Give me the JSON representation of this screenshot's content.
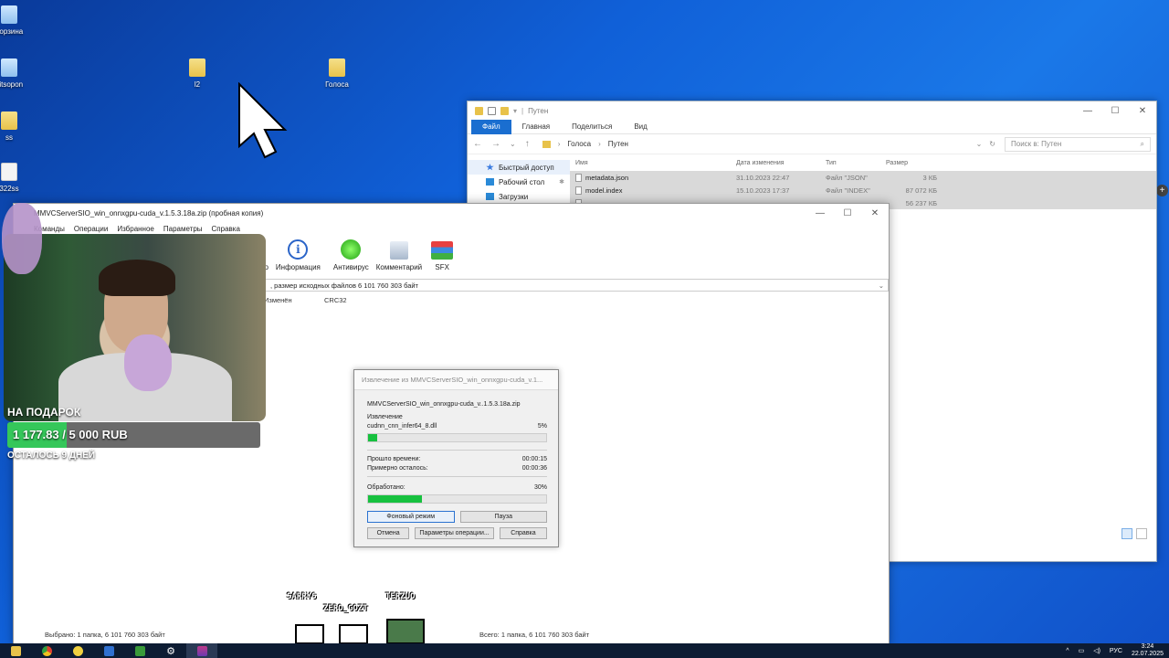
{
  "desktop": {
    "icons": [
      {
        "label": "Корзина"
      },
      {
        "label": "bitsopon"
      },
      {
        "label": "ss"
      },
      {
        "label": "322ss"
      },
      {
        "label": "l2"
      },
      {
        "label": "Голоса"
      }
    ]
  },
  "explorer": {
    "title": "Путен",
    "ribbon": [
      "Файл",
      "Главная",
      "Поделиться",
      "Вид"
    ],
    "path": [
      "Голоса",
      "Путен"
    ],
    "search_placeholder": "Поиск в: Путен",
    "sidebar": [
      {
        "label": "Быстрый доступ"
      },
      {
        "label": "Рабочий стол"
      },
      {
        "label": "Загрузки"
      }
    ],
    "columns": [
      "Имя",
      "Дата изменения",
      "Тип",
      "Размер"
    ],
    "files": [
      {
        "name": "metadata.json",
        "date": "31.10.2023 22:47",
        "type": "Файл \"JSON\"",
        "size": "3 КБ"
      },
      {
        "name": "model.index",
        "date": "15.10.2023 17:37",
        "type": "Файл \"INDEX\"",
        "size": "87 072 КБ"
      },
      {
        "name": "",
        "date": "",
        "type": "",
        "size": "56 237 КБ"
      }
    ]
  },
  "rar": {
    "title": "MMVCServerSIO_win_onnxgpu-cuda_v.1.5.3.18a.zip (пробная копия)",
    "menu": [
      "Команды",
      "Операции",
      "Избранное",
      "Параметры",
      "Справка"
    ],
    "toolbar": [
      "Информация",
      "Антивирус",
      "Комментарий",
      "SFX"
    ],
    "toolbar_partial": "ер",
    "path_text": ", размер исходных файлов 6 101 760 303 байт",
    "columns": [
      "Изменён",
      "CRC32"
    ],
    "status_left": "Выбрано: 1 папка, 6 101 760 303 байт",
    "status_right": "Всего: 1 папка, 6 101 760 303 байт"
  },
  "dialog": {
    "title": "Извлечение из MMVCServerSIO_win_onnxgpu-cuda_v.1...",
    "archive": "MMVCServerSIO_win_onnxgpu-cuda_v..1.5.3.18a.zip",
    "action": "Извлечение",
    "file": "cudnn_cnn_infer64_8.dll",
    "file_pct": "5%",
    "file_progress": 0.05,
    "elapsed_label": "Прошло времени:",
    "elapsed": "00:00:15",
    "remaining_label": "Примерно осталось:",
    "remaining": "00:00:36",
    "processed_label": "Обработано:",
    "processed_pct": "30%",
    "processed_progress": 0.3,
    "buttons": [
      "Фоновый режим",
      "Пауза",
      "Отмена",
      "Параметры операции...",
      "Справка"
    ]
  },
  "overlay": {
    "goal_label": "НА ПОДАРОК",
    "goal_amount": "1 177.83 / 5 000 RUB",
    "goal_progress": 0.2356,
    "goal_sub": "ОСТАЛОСЬ 9 ДНЕЙ",
    "names": [
      "SARRY6",
      "TERZUO",
      "ZERO_GOZT"
    ]
  },
  "taskbar": {
    "lang": "РУС",
    "time": "3:24",
    "date": "22.07.2025"
  },
  "colors": {
    "accent": "#1a6ed0",
    "progress": "#17c13f",
    "goal": "#35c75a"
  }
}
